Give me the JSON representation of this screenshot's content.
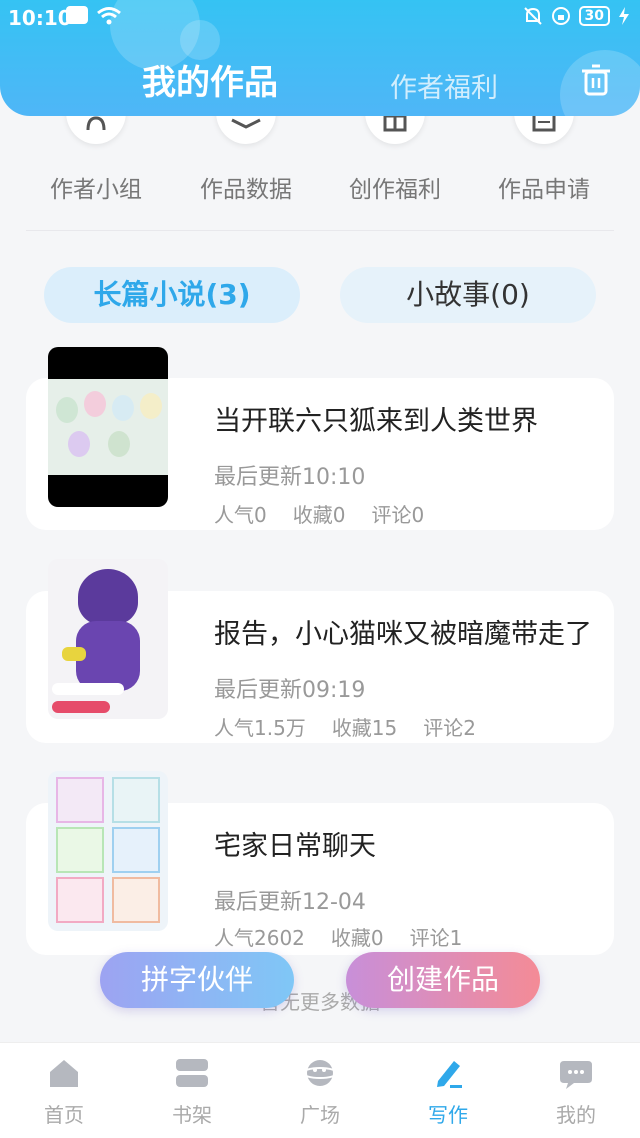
{
  "status_bar": {
    "time": "10:10",
    "battery": "30"
  },
  "header": {
    "title": "我的作品",
    "tab_welfare": "作者福利"
  },
  "shortcuts": [
    {
      "label": "作者小组",
      "icon": "group-icon"
    },
    {
      "label": "作品数据",
      "icon": "layers-icon"
    },
    {
      "label": "创作福利",
      "icon": "gift-icon"
    },
    {
      "label": "作品申请",
      "icon": "document-icon"
    }
  ],
  "tabs": {
    "novel": "长篇小说(3)",
    "story": "小故事(0)"
  },
  "works": [
    {
      "title": "当开联六只狐来到人类世界",
      "updated": "最后更新10:10",
      "popularity": "人气0",
      "favorites": "收藏0",
      "comments": "评论0"
    },
    {
      "title": "报告，小心猫咪又被暗魔带走了",
      "updated": "最后更新09:19",
      "popularity": "人气1.5万",
      "favorites": "收藏15",
      "comments": "评论2"
    },
    {
      "title": "宅家日常聊天",
      "updated": "最后更新12-04",
      "popularity": "人气2602",
      "favorites": "收藏0",
      "comments": "评论1"
    }
  ],
  "footer_text": "暂无更多数据",
  "fab": {
    "partner": "拼字伙伴",
    "create": "创建作品"
  },
  "bottom_nav": [
    {
      "label": "首页",
      "icon": "home-icon"
    },
    {
      "label": "书架",
      "icon": "bookshelf-icon"
    },
    {
      "label": "广场",
      "icon": "planet-icon"
    },
    {
      "label": "写作",
      "icon": "pen-icon"
    },
    {
      "label": "我的",
      "icon": "chat-icon"
    }
  ],
  "colors": {
    "accent": "#2fa8ea",
    "header": "#35c3f3"
  }
}
